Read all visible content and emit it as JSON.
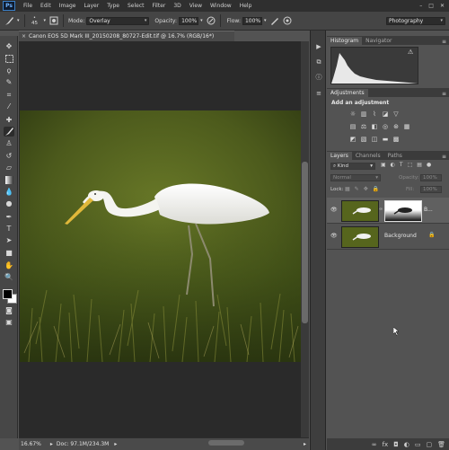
{
  "menubar": {
    "logo": "Ps",
    "items": [
      "File",
      "Edit",
      "Image",
      "Layer",
      "Type",
      "Select",
      "Filter",
      "3D",
      "View",
      "Window",
      "Help"
    ]
  },
  "options": {
    "brush_size": "45",
    "mode_label": "Mode:",
    "mode_value": "Overlay",
    "opacity_label": "Opacity:",
    "opacity_value": "100%",
    "flow_label": "Flow:",
    "flow_value": "100%",
    "workspace": "Photography"
  },
  "document": {
    "tab_title": "Canon EOS 5D Mark III_20150208_80727-Edit.tif @ 16.7% (RGB/16*)",
    "tab_close": "×",
    "zoom": "16.67%",
    "doc_info": "Doc: 97.1M/234.3M"
  },
  "panels": {
    "histogram_tab": "Histogram",
    "navigator_tab": "Navigator",
    "adjustments_tab": "Adjustments",
    "adjustments_title": "Add an adjustment",
    "layers_tab": "Layers",
    "channels_tab": "Channels",
    "paths_tab": "Paths",
    "kind_filter": "Kind",
    "blend_mode": "Normal",
    "opacity_label": "Opacity:",
    "opacity_value": "100%",
    "lock_label": "Lock:",
    "fill_label": "Fill:",
    "fill_value": "100%",
    "layers": [
      {
        "name": "B...",
        "has_mask": true
      },
      {
        "name": "Background",
        "has_mask": false
      }
    ]
  },
  "colors": {
    "foreground": "#000000",
    "background": "#ffffff",
    "accent": "#3b7fc6"
  }
}
